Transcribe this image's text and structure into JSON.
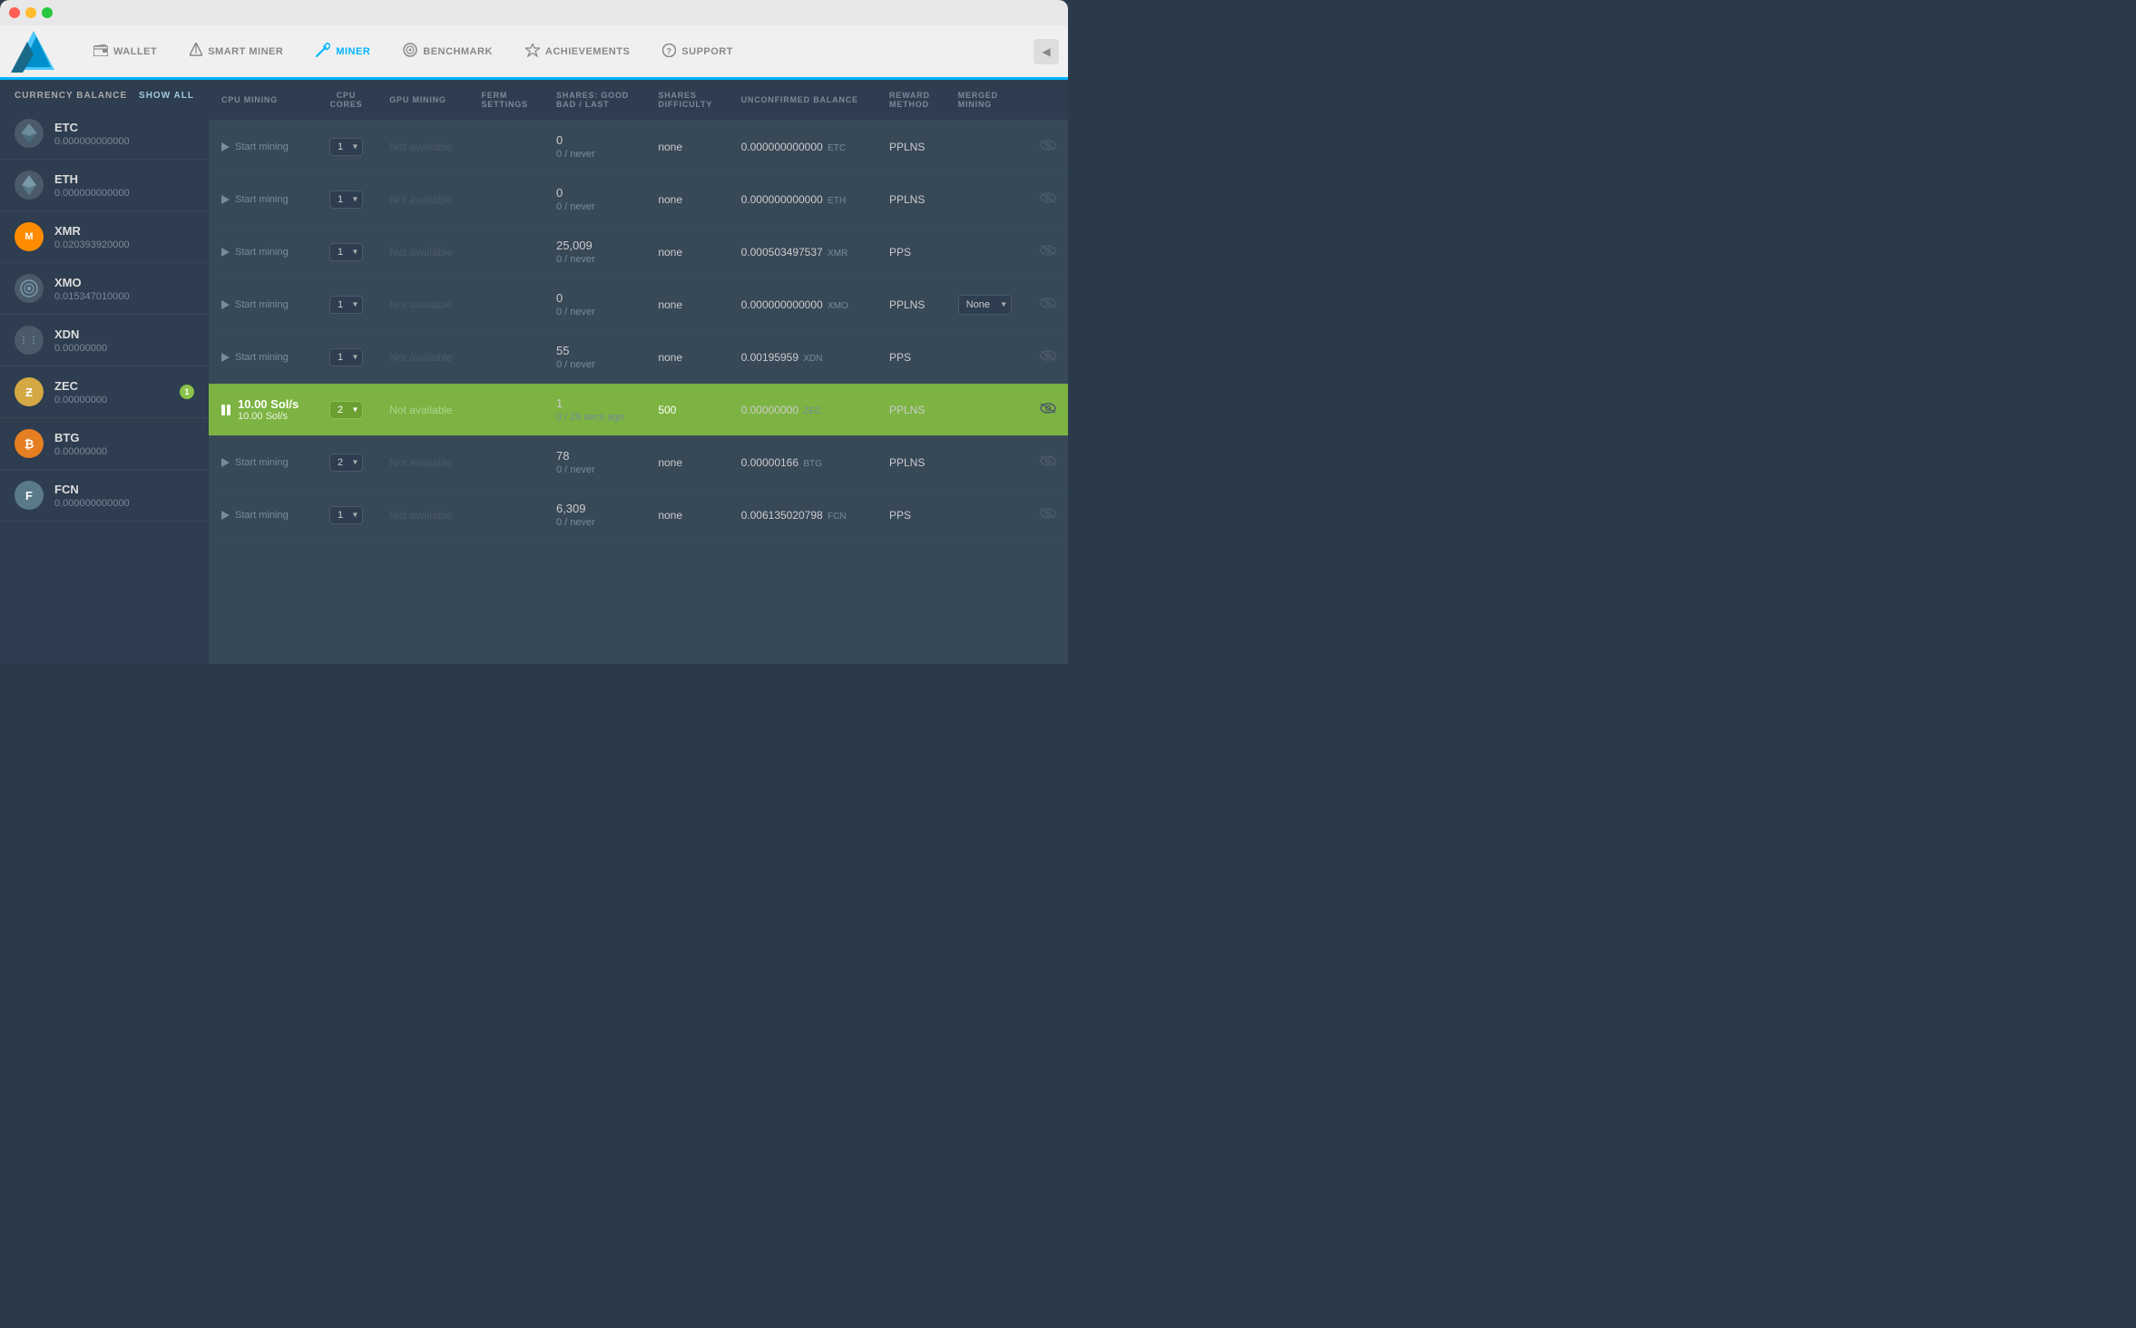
{
  "titlebar": {
    "buttons": [
      "red",
      "yellow",
      "green"
    ]
  },
  "navbar": {
    "items": [
      {
        "id": "wallet",
        "label": "WALLET",
        "icon": "💳",
        "active": false
      },
      {
        "id": "smart-miner",
        "label": "SMART MINER",
        "icon": "⚡",
        "active": false
      },
      {
        "id": "miner",
        "label": "MINER",
        "icon": "⛏",
        "active": true
      },
      {
        "id": "benchmark",
        "label": "BENCHMARK",
        "icon": "⚙",
        "active": false
      },
      {
        "id": "achievements",
        "label": "ACHIEVEMENTS",
        "icon": "★",
        "active": false
      },
      {
        "id": "support",
        "label": "SUPPORT",
        "icon": "?",
        "active": false
      }
    ],
    "collapse_label": "◀"
  },
  "sidebar": {
    "header": "CURRENCY BALANCE",
    "show_all": "Show all",
    "currencies": [
      {
        "symbol": "ETC",
        "icon": "◆",
        "name": "ETC",
        "balance": "0.000000000000",
        "badge": null
      },
      {
        "symbol": "ETH",
        "icon": "◈",
        "name": "ETH",
        "balance": "0.000000000000",
        "badge": null
      },
      {
        "symbol": "XMR",
        "icon": "M",
        "name": "XMR",
        "balance": "0.020393920000",
        "badge": null
      },
      {
        "symbol": "XMO",
        "icon": "⊙",
        "name": "XMO",
        "balance": "0.015347010000",
        "badge": null
      },
      {
        "symbol": "XDN",
        "icon": "⋮",
        "name": "XDN",
        "balance": "0.00000000",
        "badge": null
      },
      {
        "symbol": "ZEC",
        "icon": "Ƶ",
        "name": "ZEC",
        "balance": "0.00000000",
        "badge": "1"
      },
      {
        "symbol": "BTG",
        "icon": "₿",
        "name": "BTG",
        "balance": "0.00000000",
        "badge": null
      },
      {
        "symbol": "FCN",
        "icon": "F",
        "name": "FCN",
        "balance": "0.000000000000",
        "badge": null
      }
    ]
  },
  "table": {
    "columns": [
      {
        "id": "cpu-mining",
        "label": "CPU MINING"
      },
      {
        "id": "cpu-cores",
        "label": "CPU\nCORES"
      },
      {
        "id": "gpu-mining",
        "label": "GPU MINING"
      },
      {
        "id": "ferm-settings",
        "label": "FERM\nSETTINGS"
      },
      {
        "id": "shares",
        "label": "SHARES: GOOD\nBAD / LAST"
      },
      {
        "id": "difficulty",
        "label": "SHARES\nDIFFICULTY"
      },
      {
        "id": "unconfirmed",
        "label": "UNCONFIRMED BALANCE"
      },
      {
        "id": "reward",
        "label": "REWARD\nMETHOD"
      },
      {
        "id": "merged",
        "label": "MERGED\nMINING"
      },
      {
        "id": "actions",
        "label": ""
      }
    ],
    "rows": [
      {
        "currency": "ETC",
        "cpu_state": "start",
        "cpu_label": "Start mining",
        "cpu_cores": "1",
        "gpu_label": "Not available",
        "shares_good": "0",
        "shares_bad_last": "0 / never",
        "difficulty": "none",
        "unconfirmed": "0.000000000000",
        "unconfirmed_unit": "ETC",
        "reward": "PPLNS",
        "merged": null,
        "active": false
      },
      {
        "currency": "ETH",
        "cpu_state": "start",
        "cpu_label": "Start mining",
        "cpu_cores": "1",
        "gpu_label": "Not available",
        "shares_good": "0",
        "shares_bad_last": "0 / never",
        "difficulty": "none",
        "unconfirmed": "0.000000000000",
        "unconfirmed_unit": "ETH",
        "reward": "PPLNS",
        "merged": null,
        "active": false
      },
      {
        "currency": "XMR",
        "cpu_state": "start",
        "cpu_label": "Start mining",
        "cpu_cores": "1",
        "gpu_label": "Not available",
        "shares_good": "25,009",
        "shares_bad_last": "0 / never",
        "difficulty": "none",
        "unconfirmed": "0.000503497537",
        "unconfirmed_unit": "XMR",
        "reward": "PPS",
        "merged": null,
        "active": false
      },
      {
        "currency": "XMO",
        "cpu_state": "start",
        "cpu_label": "Start mining",
        "cpu_cores": "1",
        "gpu_label": "Not available",
        "shares_good": "0",
        "shares_bad_last": "0 / never",
        "difficulty": "none",
        "unconfirmed": "0.000000000000",
        "unconfirmed_unit": "XMO",
        "reward": "PPLNS",
        "merged": "None",
        "active": false
      },
      {
        "currency": "XDN",
        "cpu_state": "start",
        "cpu_label": "Start mining",
        "cpu_cores": "1",
        "gpu_label": "Not available",
        "shares_good": "55",
        "shares_bad_last": "0 / never",
        "difficulty": "none",
        "unconfirmed": "0.00195959",
        "unconfirmed_unit": "XDN",
        "reward": "PPS",
        "merged": null,
        "active": false
      },
      {
        "currency": "ZEC",
        "cpu_state": "pause",
        "cpu_label": "10.00 Sol/s\n10.00 Sol/s",
        "cpu_cores": "2",
        "gpu_label": "Not available",
        "shares_good": "1",
        "shares_bad_last": "0 / 29 secs ago",
        "difficulty": "500",
        "unconfirmed": "0.00000000",
        "unconfirmed_unit": "ZEC",
        "reward": "PPLNS",
        "merged": null,
        "active": true
      },
      {
        "currency": "BTG",
        "cpu_state": "start",
        "cpu_label": "Start mining",
        "cpu_cores": "2",
        "gpu_label": "Not available",
        "shares_good": "78",
        "shares_bad_last": "0 / never",
        "difficulty": "none",
        "unconfirmed": "0.00000166",
        "unconfirmed_unit": "BTG",
        "reward": "PPLNS",
        "merged": null,
        "active": false
      },
      {
        "currency": "FCN",
        "cpu_state": "start",
        "cpu_label": "Start mining",
        "cpu_cores": "1",
        "gpu_label": "Not available",
        "shares_good": "6,309",
        "shares_bad_last": "0 / never",
        "difficulty": "none",
        "unconfirmed": "0.006135020798",
        "unconfirmed_unit": "FCN",
        "reward": "PPS",
        "merged": null,
        "active": false
      }
    ]
  }
}
